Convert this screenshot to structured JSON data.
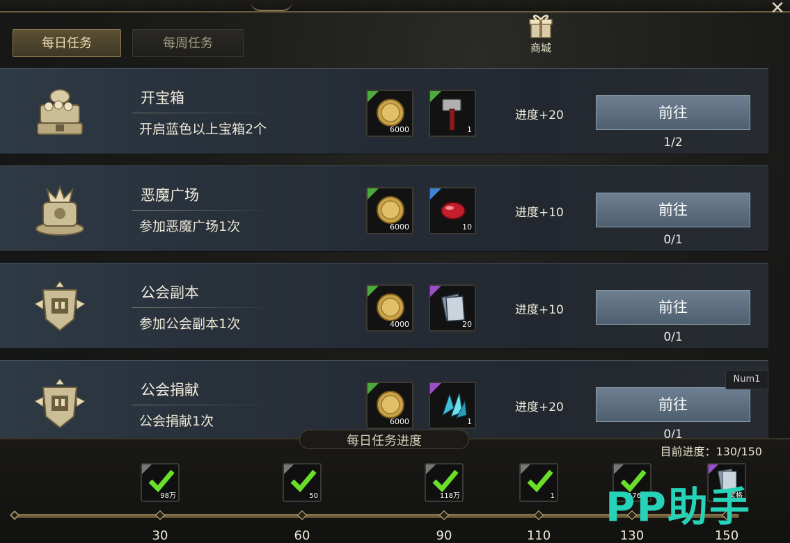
{
  "tabs": [
    {
      "label": "每日任务",
      "active": true
    },
    {
      "label": "每周任务",
      "active": false
    }
  ],
  "shop": {
    "label": "商城",
    "icon": "gift-box-icon"
  },
  "close_icon": "close-icon",
  "tasks": [
    {
      "title": "开宝箱",
      "desc": "开启蓝色以上宝箱2个",
      "emblem": "treasure-chest-icon",
      "rewards": [
        {
          "icon": "gold-coin-icon",
          "qty": "6000",
          "rarity": "green"
        },
        {
          "icon": "hammer-icon",
          "qty": "1",
          "rarity": "green"
        }
      ],
      "points": "进度+20",
      "button": "前往",
      "progress": "1/2"
    },
    {
      "title": "恶魔广场",
      "desc": "参加恶魔广场1次",
      "emblem": "demon-square-icon",
      "rewards": [
        {
          "icon": "gold-coin-icon",
          "qty": "6000",
          "rarity": "green"
        },
        {
          "icon": "red-gem-icon",
          "qty": "10",
          "rarity": "blue"
        }
      ],
      "points": "进度+10",
      "button": "前往",
      "progress": "0/1"
    },
    {
      "title": "公会副本",
      "desc": "参加公会副本1次",
      "emblem": "guild-banner-icon",
      "rewards": [
        {
          "icon": "gold-coin-icon",
          "qty": "4000",
          "rarity": "green"
        },
        {
          "icon": "scroll-card-icon",
          "qty": "20",
          "rarity": "purple"
        }
      ],
      "points": "进度+10",
      "button": "前往",
      "progress": "0/1"
    },
    {
      "title": "公会捐献",
      "desc": "公会捐献1次",
      "emblem": "guild-banner-icon",
      "rewards": [
        {
          "icon": "gold-coin-icon",
          "qty": "6000",
          "rarity": "green"
        },
        {
          "icon": "blue-crystal-icon",
          "qty": "1",
          "rarity": "purple"
        }
      ],
      "points": "进度+20",
      "button": "前往",
      "progress": "0/1"
    }
  ],
  "tooltip": "Num1",
  "daily_progress": {
    "title": "每日任务进度",
    "current_label": "目前进度：130/150",
    "current": 130,
    "max": 150,
    "milestones": [
      {
        "value": "30",
        "qty": "98万",
        "claimed": true
      },
      {
        "value": "60",
        "qty": "50",
        "claimed": true
      },
      {
        "value": "90",
        "qty": "118万",
        "claimed": true
      },
      {
        "value": "110",
        "qty": "1",
        "claimed": true
      },
      {
        "value": "130",
        "qty": "176万",
        "claimed": true
      },
      {
        "value": "150",
        "qty": "奖格",
        "claimed": false
      }
    ]
  },
  "watermark": "PP助手",
  "colors": {
    "accent_gold": "#8f7d52",
    "button_blue": "#5e7082",
    "rarity_green": "#4caa3d",
    "rarity_blue": "#3a83d9",
    "rarity_purple": "#9a4ec8",
    "watermark": "#27d3b8"
  }
}
